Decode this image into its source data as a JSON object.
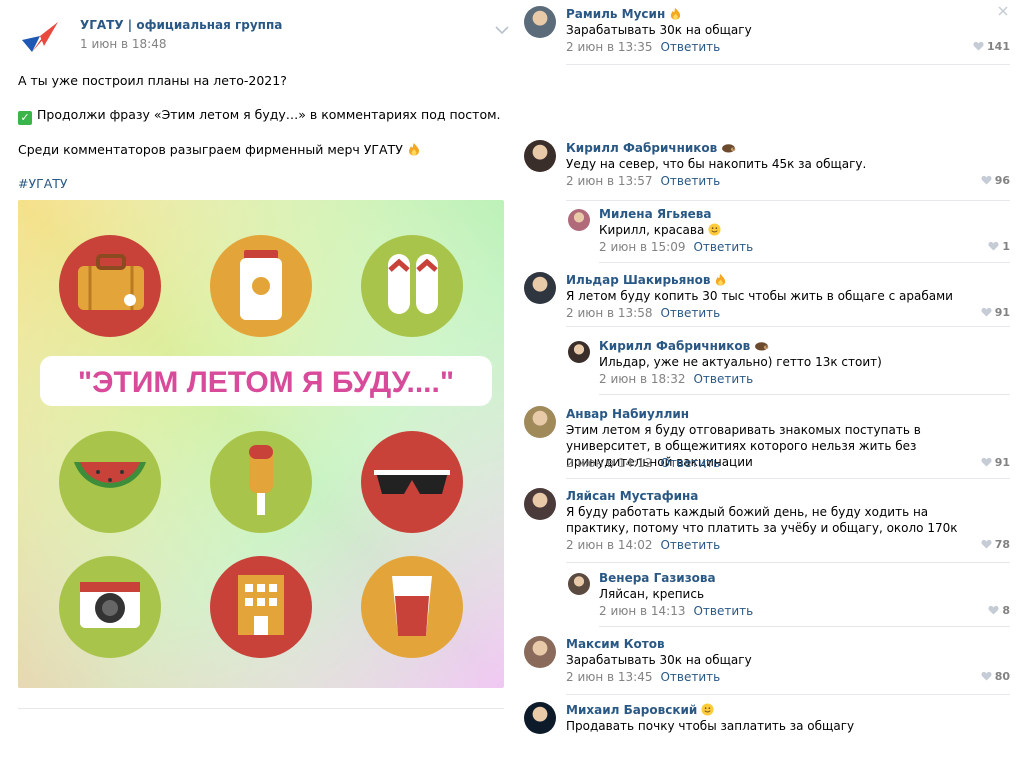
{
  "post": {
    "group_name": "УГАТУ | официальная группа",
    "date": "1 июн в 18:48",
    "line1": "А ты уже построил планы на лето-2021?",
    "line2": "Продолжи фразу «Этим летом я буду…» в комментариях под постом.",
    "line3": "Среди комментаторов разыграем фирменный мерч УГАТУ",
    "hashtag": "#УГАТУ",
    "image_caption": "\"ЭТИМ ЛЕТОМ Я БУДУ....\""
  },
  "colors": {
    "link": "#2a5885",
    "meta": "#828282",
    "divider": "#e7e8ec",
    "icon_red": "#c8423a",
    "icon_orange": "#e3a53a",
    "icon_green": "#a9c44a",
    "caption_pink": "#e0478e"
  },
  "comments": [
    {
      "name": "Рамиль Мусин",
      "badge": "fire-icon",
      "text": "Зарабатывать 30к на общагу",
      "date": "2 июн в 13:35",
      "reply": "Ответить",
      "likes": "141"
    },
    {
      "name": "Кирилл Фабричников",
      "badge": "hedgehog-icon",
      "text": "Уеду на север, что бы накопить 45к за общагу.",
      "date": "2 июн в 13:57",
      "reply": "Ответить",
      "likes": "96"
    },
    {
      "name": "Милена Ягьяева",
      "badge": "",
      "text": "Кирилл, красава",
      "date": "2 июн в 15:09",
      "reply": "Ответить",
      "likes": "1"
    },
    {
      "name": "Ильдар Шакирьянов",
      "badge": "fire-icon",
      "text": "Я летом буду копить 30 тыс чтобы жить в общаге с арабами",
      "date": "2 июн в 13:58",
      "reply": "Ответить",
      "likes": "91"
    },
    {
      "name": "Кирилл Фабричников",
      "badge": "hedgehog-icon",
      "text": "Ильдар, уже не актуально) гетто 13к стоит)",
      "date": "2 июн в 18:32",
      "reply": "Ответить",
      "likes": ""
    },
    {
      "name": "Анвар Набиуллин",
      "badge": "",
      "text": "Этим летом я буду отговаривать знакомых поступать в университет, в общежитиях которого нельзя жить без принудительной вакцинации",
      "date": "2 июн в 14:12",
      "reply": "Ответить",
      "likes": "91"
    },
    {
      "name": "Ляйсан Мустафина",
      "badge": "",
      "text": "Я буду работать каждый божий день, не буду ходить на практику, потому что платить за учёбу и общагу, около 170к",
      "date": "2 июн в 14:02",
      "reply": "Ответить",
      "likes": "78"
    },
    {
      "name": "Венера Газизова",
      "badge": "",
      "text": "Ляйсан, крепись",
      "date": "2 июн в 14:13",
      "reply": "Ответить",
      "likes": "8"
    },
    {
      "name": "Максим Котов",
      "badge": "",
      "text": "Зарабатывать 30к на общагу",
      "date": "2 июн в 13:45",
      "reply": "Ответить",
      "likes": "80"
    },
    {
      "name": "Михаил Баровский",
      "badge": "smile-icon",
      "text": "Продавать почку чтобы заплатить за общагу",
      "date": "",
      "reply": "",
      "likes": ""
    }
  ]
}
